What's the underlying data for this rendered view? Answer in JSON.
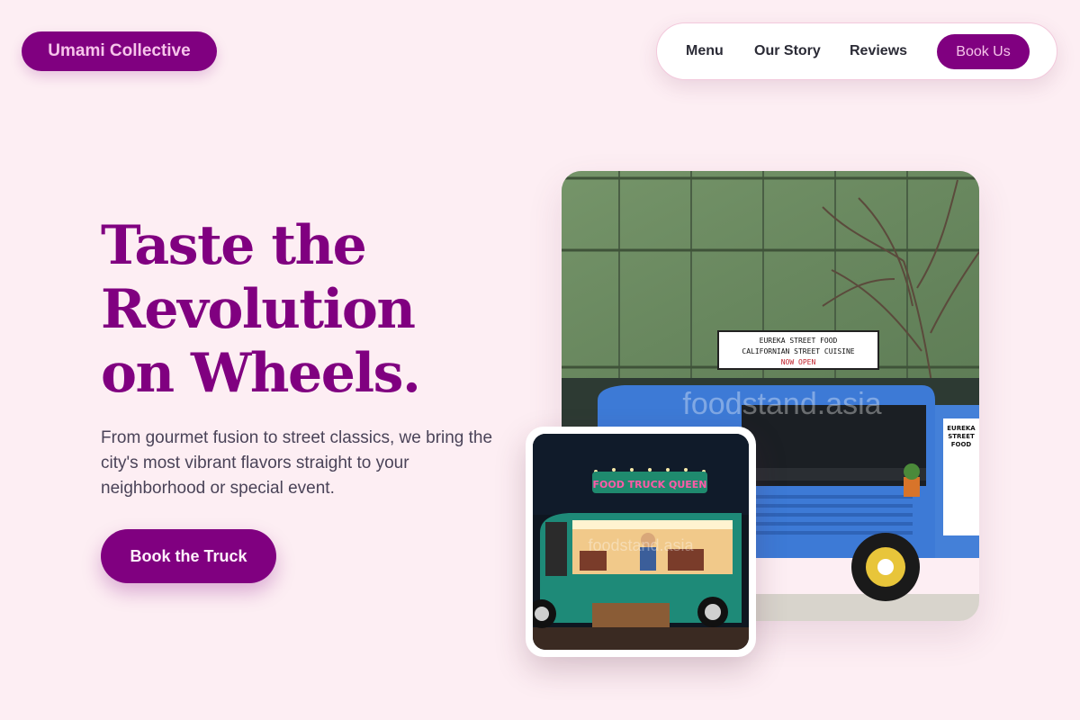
{
  "brand": {
    "name": "Umami Collective"
  },
  "nav": {
    "links": [
      "Menu",
      "Our Story",
      "Reviews"
    ],
    "cta": "Book Us"
  },
  "hero": {
    "title_lines": [
      "Taste the",
      "Revolution",
      "on Wheels."
    ],
    "subtitle": "From gourmet fusion to street classics, we bring the city's most vibrant flavors straight to your neighborhood or special event.",
    "cta": "Book the Truck"
  },
  "images": {
    "main": {
      "sign_lines": [
        "EUREKA STREET FOOD",
        "CALIFORNIAN STREET CUISINE",
        "NOW OPEN"
      ],
      "watermark": "foodstand.asia",
      "menu_board": [
        "EUREKA",
        "STREET",
        "FOOD"
      ]
    },
    "small": {
      "sign": "FOOD TRUCK QUEEN",
      "watermark": "foodstand.asia"
    }
  },
  "colors": {
    "background": "#fdeef3",
    "brand": "#800080",
    "brand_text": "#f6c4ea",
    "truck_blue": "#3d7ad6",
    "truck_green": "#1e8a78"
  }
}
